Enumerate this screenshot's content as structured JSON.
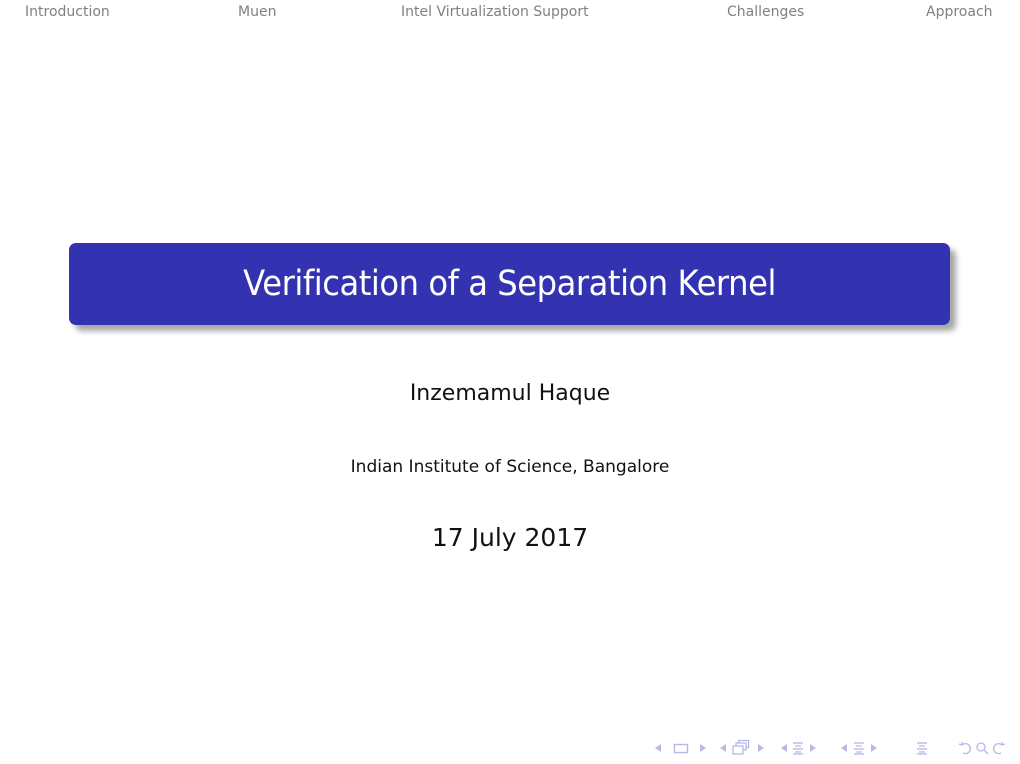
{
  "headline": {
    "sections": [
      {
        "label": "Introduction"
      },
      {
        "label": "Muen"
      },
      {
        "label": "Intel Virtualization Support"
      },
      {
        "label": "Challenges"
      },
      {
        "label": "Approach"
      }
    ]
  },
  "title_page": {
    "title": "Verification of a Separation Kernel",
    "author": "Inzemamul Haque",
    "institute": "Indian Institute of Science, Bangalore",
    "date": "17 July 2017"
  },
  "colors": {
    "title_box": "#3333b2",
    "title_text": "#ffffff",
    "nav_text": "#808080",
    "nav_symbols": "#b8b8e6"
  },
  "navigation_symbols": [
    {
      "icon": "frame-prev-icon"
    },
    {
      "icon": "frame-icon"
    },
    {
      "icon": "frame-next-icon"
    },
    {
      "icon": "subsection-prev-icon"
    },
    {
      "icon": "subsection-icon"
    },
    {
      "icon": "subsection-next-icon"
    },
    {
      "icon": "section-prev-icon"
    },
    {
      "icon": "section-icon"
    },
    {
      "icon": "section-next-icon"
    },
    {
      "icon": "subsection-prev-2-icon"
    },
    {
      "icon": "subsection-2-icon"
    },
    {
      "icon": "subsection-next-2-icon"
    },
    {
      "icon": "document-icon"
    },
    {
      "icon": "back-icon"
    },
    {
      "icon": "search-icon"
    },
    {
      "icon": "forward-icon"
    }
  ]
}
